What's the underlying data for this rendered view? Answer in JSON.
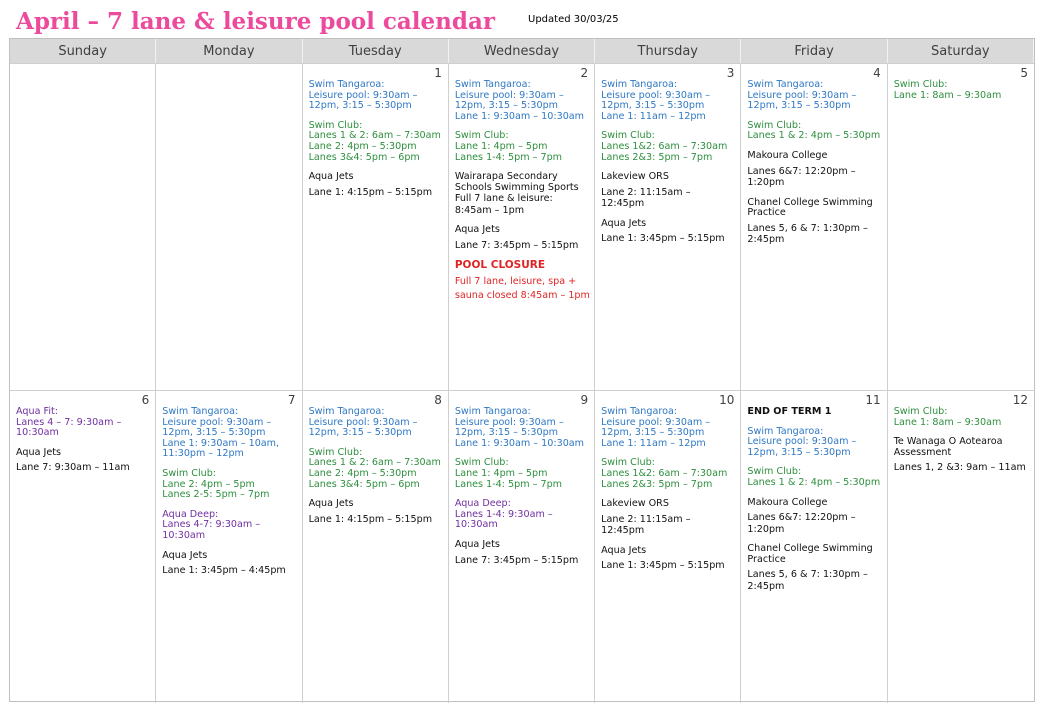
{
  "header": {
    "title": "April – 7 lane & leisure pool calendar",
    "updated": "Updated 30/03/25"
  },
  "days_of_week": [
    "Sunday",
    "Monday",
    "Tuesday",
    "Wednesday",
    "Thursday",
    "Friday",
    "Saturday"
  ],
  "colors": {
    "title": "#ec4a9c",
    "swim_tangaroa": "#2f78c4",
    "swim_club": "#2e8f3e",
    "aqua": "#7030a0",
    "closure": "#e02424",
    "header_bg": "#d9d9d9"
  },
  "weeks": [
    {
      "days": [
        {
          "date": "",
          "events": []
        },
        {
          "date": "",
          "events": []
        },
        {
          "date": "1",
          "events": [
            {
              "color": "blue",
              "heading": "Swim Tangaroa:",
              "details": "Leisure pool: 9:30am – 12pm, 3:15 – 5:30pm"
            },
            {
              "color": "green",
              "heading": "Swim Club:",
              "details": "Lanes 1 & 2: 6am – 7:30am\nLane 2: 4pm – 5:30pm\nLanes 3&4: 5pm – 6pm"
            },
            {
              "color": "black",
              "heading": "Aqua Jets",
              "details": "Lane 1: 4:15pm – 5:15pm"
            }
          ]
        },
        {
          "date": "2",
          "events": [
            {
              "color": "blue",
              "heading": "Swim Tangaroa:",
              "details": "Leisure pool: 9:30am – 12pm, 3:15 – 5:30pm\nLane 1: 9:30am – 10:30am"
            },
            {
              "color": "green",
              "heading": "Swim Club:",
              "details": "Lane 1: 4pm – 5pm\nLanes 1-4: 5pm – 7pm"
            },
            {
              "color": "black tight",
              "heading": "Wairarapa Secondary Schools Swimming Sports",
              "details": "Full 7 lane & leisure: 8:45am – 1pm"
            },
            {
              "color": "black",
              "heading": "Aqua Jets",
              "details": "Lane 7: 3:45pm – 5:15pm"
            },
            {
              "color": "red",
              "heading": "POOL CLOSURE",
              "details": "Full 7 lane, leisure, spa + sauna closed 8:45am – 1pm"
            }
          ]
        },
        {
          "date": "3",
          "events": [
            {
              "color": "blue",
              "heading": "Swim Tangaroa:",
              "details": "Leisure pool: 9:30am – 12pm, 3:15 – 5:30pm\nLane 1: 11am – 12pm"
            },
            {
              "color": "green",
              "heading": "Swim Club:",
              "details": "Lanes 1&2: 6am – 7:30am\nLanes 2&3: 5pm – 7pm"
            },
            {
              "color": "black",
              "heading": "Lakeview ORS",
              "details": "Lane 2: 11:15am – 12:45pm"
            },
            {
              "color": "black",
              "heading": "Aqua Jets",
              "details": "Lane 1: 3:45pm – 5:15pm"
            }
          ]
        },
        {
          "date": "4",
          "events": [
            {
              "color": "blue",
              "heading": "Swim Tangaroa:",
              "details": "Leisure pool: 9:30am – 12pm, 3:15 – 5:30pm"
            },
            {
              "color": "green",
              "heading": "Swim Club:",
              "details": "Lanes 1 & 2: 4pm – 5:30pm"
            },
            {
              "color": "black",
              "heading": "Makoura College",
              "details": "Lanes 6&7: 12:20pm – 1:20pm"
            },
            {
              "color": "black",
              "heading": "Chanel College Swimming Practice",
              "details": "Lanes 5, 6 & 7: 1:30pm – 2:45pm"
            }
          ]
        },
        {
          "date": "5",
          "events": [
            {
              "color": "green",
              "heading": "Swim Club:",
              "details": "Lane 1: 8am – 9:30am"
            }
          ]
        }
      ]
    },
    {
      "days": [
        {
          "date": "6",
          "events": [
            {
              "color": "purple",
              "heading": "Aqua Fit:",
              "details": "Lanes 4 – 7: 9:30am – 10:30am"
            },
            {
              "color": "black",
              "heading": "Aqua Jets",
              "details": "Lane 7: 9:30am – 11am"
            }
          ]
        },
        {
          "date": "7",
          "events": [
            {
              "color": "blue",
              "heading": "Swim Tangaroa:",
              "details": "Leisure pool: 9:30am – 12pm, 3:15 – 5:30pm\nLane 1: 9:30am – 10am, 11:30pm – 12pm"
            },
            {
              "color": "green",
              "heading": "Swim Club:",
              "details": "Lane 2: 4pm – 5pm\nLanes 2-5: 5pm – 7pm"
            },
            {
              "color": "purple",
              "heading": "Aqua Deep:",
              "details": "Lanes 4-7: 9:30am – 10:30am"
            },
            {
              "color": "black",
              "heading": "Aqua Jets",
              "details": "Lane 1: 3:45pm – 4:45pm"
            }
          ]
        },
        {
          "date": "8",
          "events": [
            {
              "color": "blue",
              "heading": "Swim Tangaroa:",
              "details": "Leisure pool: 9:30am – 12pm, 3:15 – 5:30pm"
            },
            {
              "color": "green",
              "heading": "Swim Club:",
              "details": "Lanes 1 & 2: 6am – 7:30am\nLane 2: 4pm – 5:30pm\nLanes 3&4: 5pm – 6pm"
            },
            {
              "color": "black",
              "heading": "Aqua Jets",
              "details": "Lane 1: 4:15pm – 5:15pm"
            }
          ]
        },
        {
          "date": "9",
          "events": [
            {
              "color": "blue",
              "heading": "Swim Tangaroa:",
              "details": "Leisure pool: 9:30am – 12pm, 3:15 – 5:30pm\nLane 1: 9:30am – 10:30am"
            },
            {
              "color": "green",
              "heading": "Swim Club:",
              "details": "Lane 1: 4pm – 5pm\nLanes 1-4: 5pm – 7pm"
            },
            {
              "color": "purple",
              "heading": "Aqua Deep:",
              "details": "Lanes 1-4: 9:30am – 10:30am"
            },
            {
              "color": "black",
              "heading": "Aqua Jets",
              "details": "Lane 7: 3:45pm – 5:15pm"
            }
          ]
        },
        {
          "date": "10",
          "events": [
            {
              "color": "blue",
              "heading": "Swim Tangaroa:",
              "details": "Leisure pool: 9:30am – 12pm, 3:15 – 5:30pm\nLane 1: 11am – 12pm"
            },
            {
              "color": "green",
              "heading": "Swim Club:",
              "details": "Lanes 1&2: 6am – 7:30am\nLanes 2&3: 5pm – 7pm"
            },
            {
              "color": "black",
              "heading": "Lakeview ORS",
              "details": "Lane 2: 11:15am – 12:45pm"
            },
            {
              "color": "black",
              "heading": "Aqua Jets",
              "details": "Lane 1: 3:45pm – 5:15pm"
            }
          ]
        },
        {
          "date": "11",
          "events": [
            {
              "color": "black bold",
              "heading": "END OF TERM 1",
              "details": ""
            },
            {
              "color": "blue",
              "heading": "Swim Tangaroa:",
              "details": "Leisure pool: 9:30am – 12pm, 3:15 – 5:30pm"
            },
            {
              "color": "green",
              "heading": "Swim Club:",
              "details": "Lanes 1 & 2: 4pm – 5:30pm"
            },
            {
              "color": "black",
              "heading": "Makoura College",
              "details": "Lanes 6&7: 12:20pm – 1:20pm"
            },
            {
              "color": "black",
              "heading": "Chanel College Swimming Practice",
              "details": "Lanes 5, 6 & 7: 1:30pm – 2:45pm"
            }
          ]
        },
        {
          "date": "12",
          "events": [
            {
              "color": "green",
              "heading": "Swim Club:",
              "details": "Lane 1: 8am – 9:30am"
            },
            {
              "color": "black",
              "heading": "Te Wanaga O Aotearoa Assessment",
              "details": "Lanes 1, 2 &3: 9am – 11am"
            }
          ]
        }
      ]
    }
  ]
}
